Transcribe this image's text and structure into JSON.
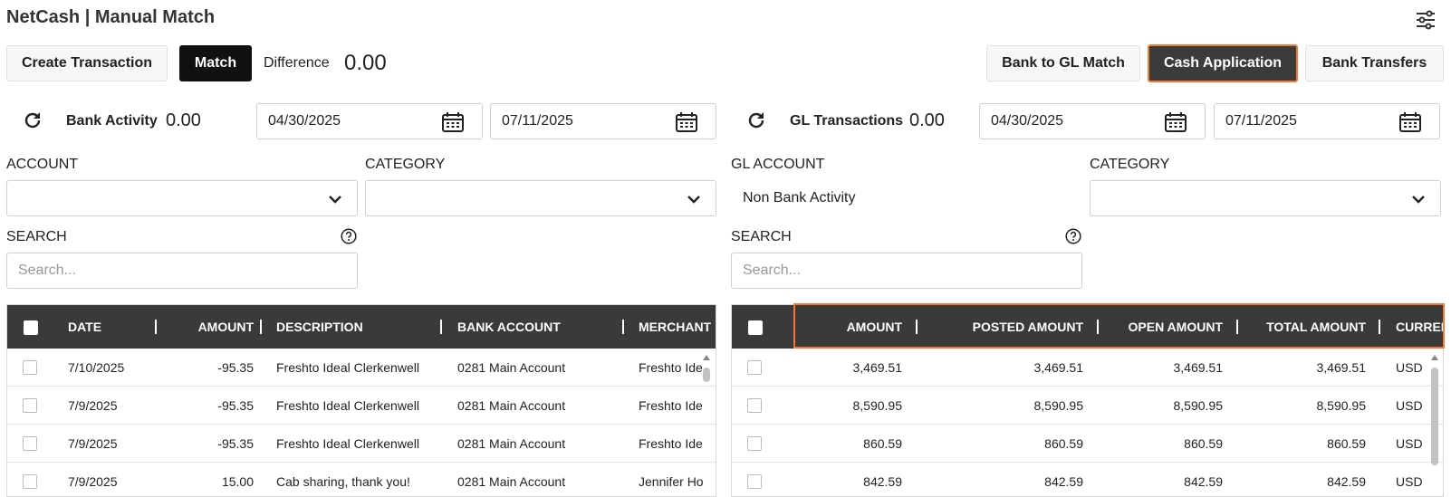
{
  "header": {
    "title": "NetCash | Manual Match",
    "settings_icon": "sliders-icon"
  },
  "toolbar": {
    "create_transaction": "Create Transaction",
    "match": "Match",
    "difference_label": "Difference",
    "difference_value": "0.00",
    "bank_to_gl": "Bank to GL Match",
    "cash_application": "Cash Application",
    "bank_transfers": "Bank Transfers"
  },
  "bank": {
    "label": "Bank Activity",
    "value": "0.00",
    "date_from": "04/30/2025",
    "date_to": "07/11/2025",
    "account_label": "ACCOUNT",
    "category_label": "CATEGORY",
    "search_label": "SEARCH",
    "search_placeholder": "Search...",
    "columns": [
      "DATE",
      "AMOUNT",
      "DESCRIPTION",
      "BANK ACCOUNT",
      "MERCHANT"
    ],
    "rows": [
      {
        "date": "7/10/2025",
        "amount": "-95.35",
        "description": "Freshto Ideal Clerkenwell",
        "bank_account": "0281 Main Account",
        "merchant": "Freshto Ide"
      },
      {
        "date": "7/9/2025",
        "amount": "-95.35",
        "description": "Freshto Ideal Clerkenwell",
        "bank_account": "0281 Main Account",
        "merchant": "Freshto Ide"
      },
      {
        "date": "7/9/2025",
        "amount": "-95.35",
        "description": "Freshto Ideal Clerkenwell",
        "bank_account": "0281 Main Account",
        "merchant": "Freshto Ide"
      },
      {
        "date": "7/9/2025",
        "amount": "15.00",
        "description": "Cab sharing, thank you!",
        "bank_account": "0281 Main Account",
        "merchant": "Jennifer Ho"
      }
    ]
  },
  "gl": {
    "label": "GL Transactions",
    "value": "0.00",
    "date_from": "04/30/2025",
    "date_to": "07/11/2025",
    "account_label": "GL ACCOUNT",
    "account_value": "Non Bank Activity",
    "category_label": "CATEGORY",
    "search_label": "SEARCH",
    "search_placeholder": "Search...",
    "columns": [
      "AMOUNT",
      "POSTED AMOUNT",
      "OPEN AMOUNT",
      "TOTAL AMOUNT",
      "CURRENCY"
    ],
    "rows": [
      {
        "amount": "3,469.51",
        "posted": "3,469.51",
        "open": "3,469.51",
        "total": "3,469.51",
        "currency": "USD"
      },
      {
        "amount": "8,590.95",
        "posted": "8,590.95",
        "open": "8,590.95",
        "total": "8,590.95",
        "currency": "USD"
      },
      {
        "amount": "860.59",
        "posted": "860.59",
        "open": "860.59",
        "total": "860.59",
        "currency": "USD"
      },
      {
        "amount": "842.59",
        "posted": "842.59",
        "open": "842.59",
        "total": "842.59",
        "currency": "USD"
      }
    ]
  },
  "colors": {
    "header_bg": "#3a3a3a",
    "highlight": "#f07a35",
    "cash_btn_bg": "#3b3b3b",
    "match_btn_bg": "#111111"
  }
}
